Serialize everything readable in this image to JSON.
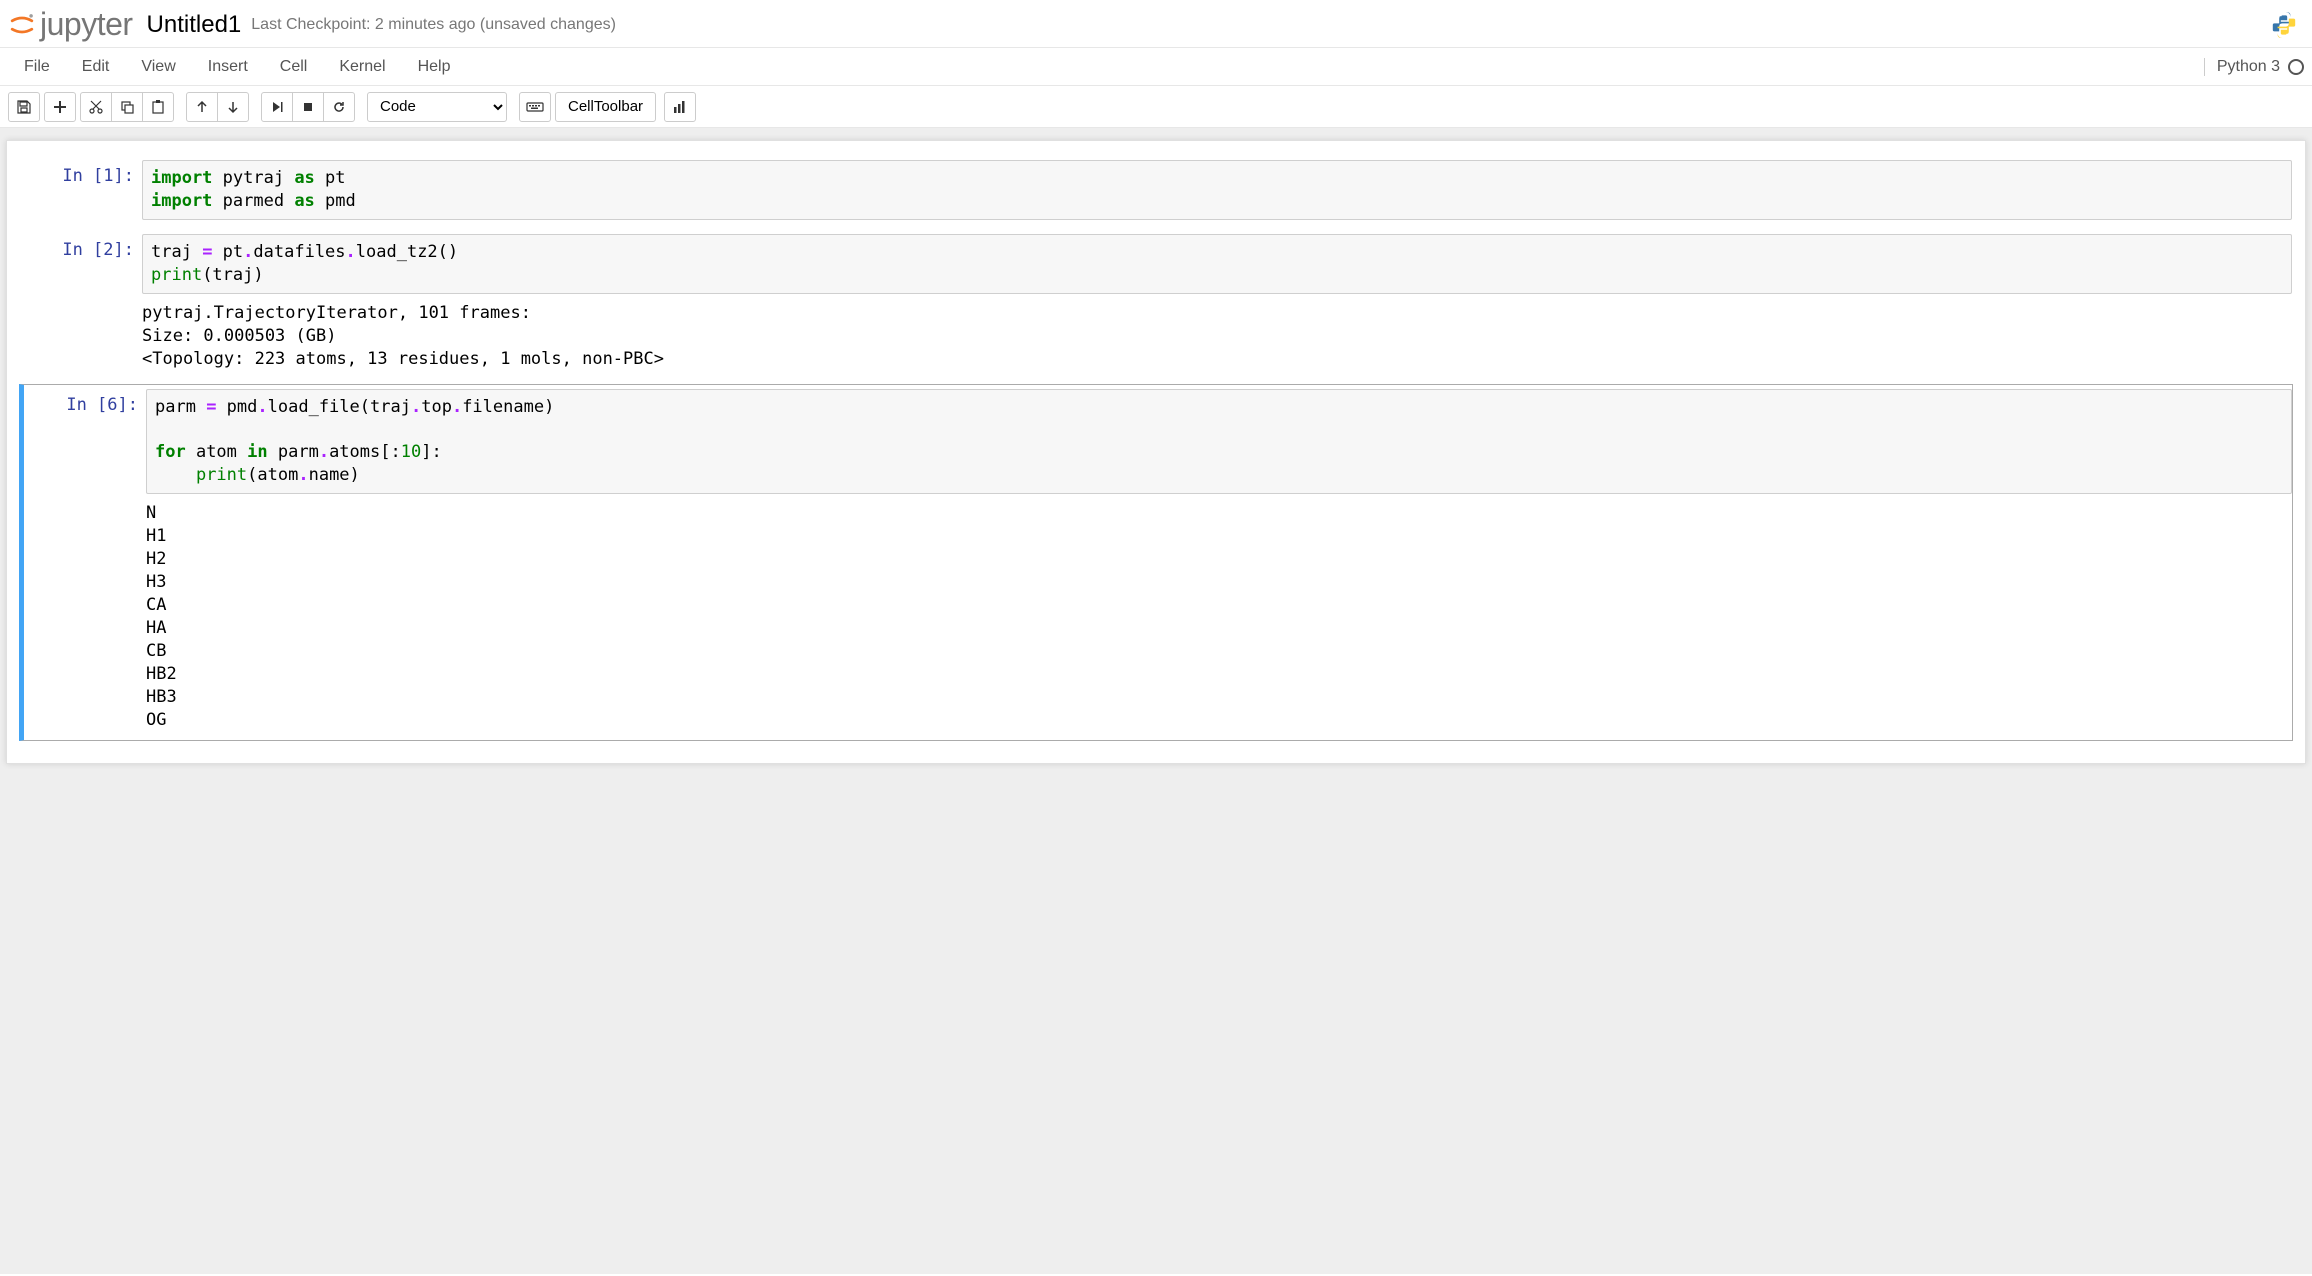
{
  "header": {
    "logo_text": "jupyter",
    "notebook_name": "Untitled1",
    "checkpoint_status": "Last Checkpoint: 2 minutes ago (unsaved changes)"
  },
  "menubar": {
    "items": [
      "File",
      "Edit",
      "View",
      "Insert",
      "Cell",
      "Kernel",
      "Help"
    ],
    "kernel_name": "Python 3"
  },
  "toolbar": {
    "cell_type": "Code",
    "celltoolbar_label": "CellToolbar"
  },
  "cells": [
    {
      "prompt": "In [1]:",
      "code_tokens": [
        [
          "k",
          "import"
        ],
        [
          "n",
          " pytraj "
        ],
        [
          "k",
          "as"
        ],
        [
          "n",
          " pt\n"
        ],
        [
          "k",
          "import"
        ],
        [
          "n",
          " parmed "
        ],
        [
          "k",
          "as"
        ],
        [
          "n",
          " pmd"
        ]
      ],
      "output": ""
    },
    {
      "prompt": "In [2]:",
      "code_tokens": [
        [
          "n",
          "traj "
        ],
        [
          "op",
          "="
        ],
        [
          "n",
          " pt"
        ],
        [
          "op",
          "."
        ],
        [
          "n",
          "datafiles"
        ],
        [
          "op",
          "."
        ],
        [
          "n",
          "load_tz2"
        ],
        [
          "n",
          "()\n"
        ],
        [
          "nb",
          "print"
        ],
        [
          "n",
          "(traj)"
        ]
      ],
      "output": "pytraj.TrajectoryIterator, 101 frames: \nSize: 0.000503 (GB)\n<Topology: 223 atoms, 13 residues, 1 mols, non-PBC>\n"
    },
    {
      "prompt": "In [6]:",
      "selected": true,
      "code_tokens": [
        [
          "n",
          "parm "
        ],
        [
          "op",
          "="
        ],
        [
          "n",
          " pmd"
        ],
        [
          "op",
          "."
        ],
        [
          "n",
          "load_file"
        ],
        [
          "n",
          "("
        ],
        [
          "n",
          "traj"
        ],
        [
          "op",
          "."
        ],
        [
          "n",
          "top"
        ],
        [
          "op",
          "."
        ],
        [
          "n",
          "filename"
        ],
        [
          "n",
          ")\n\n"
        ],
        [
          "k",
          "for"
        ],
        [
          "n",
          " atom "
        ],
        [
          "k",
          "in"
        ],
        [
          "n",
          " parm"
        ],
        [
          "op",
          "."
        ],
        [
          "n",
          "atoms"
        ],
        [
          "n",
          "["
        ],
        [
          "n",
          ":"
        ],
        [
          "num",
          "10"
        ],
        [
          "n",
          "]:\n    "
        ],
        [
          "nb",
          "print"
        ],
        [
          "n",
          "("
        ],
        [
          "n",
          "atom"
        ],
        [
          "op",
          "."
        ],
        [
          "n",
          "name"
        ],
        [
          "n",
          ")"
        ]
      ],
      "output": "N\nH1\nH2\nH3\nCA\nHA\nCB\nHB2\nHB3\nOG"
    }
  ]
}
